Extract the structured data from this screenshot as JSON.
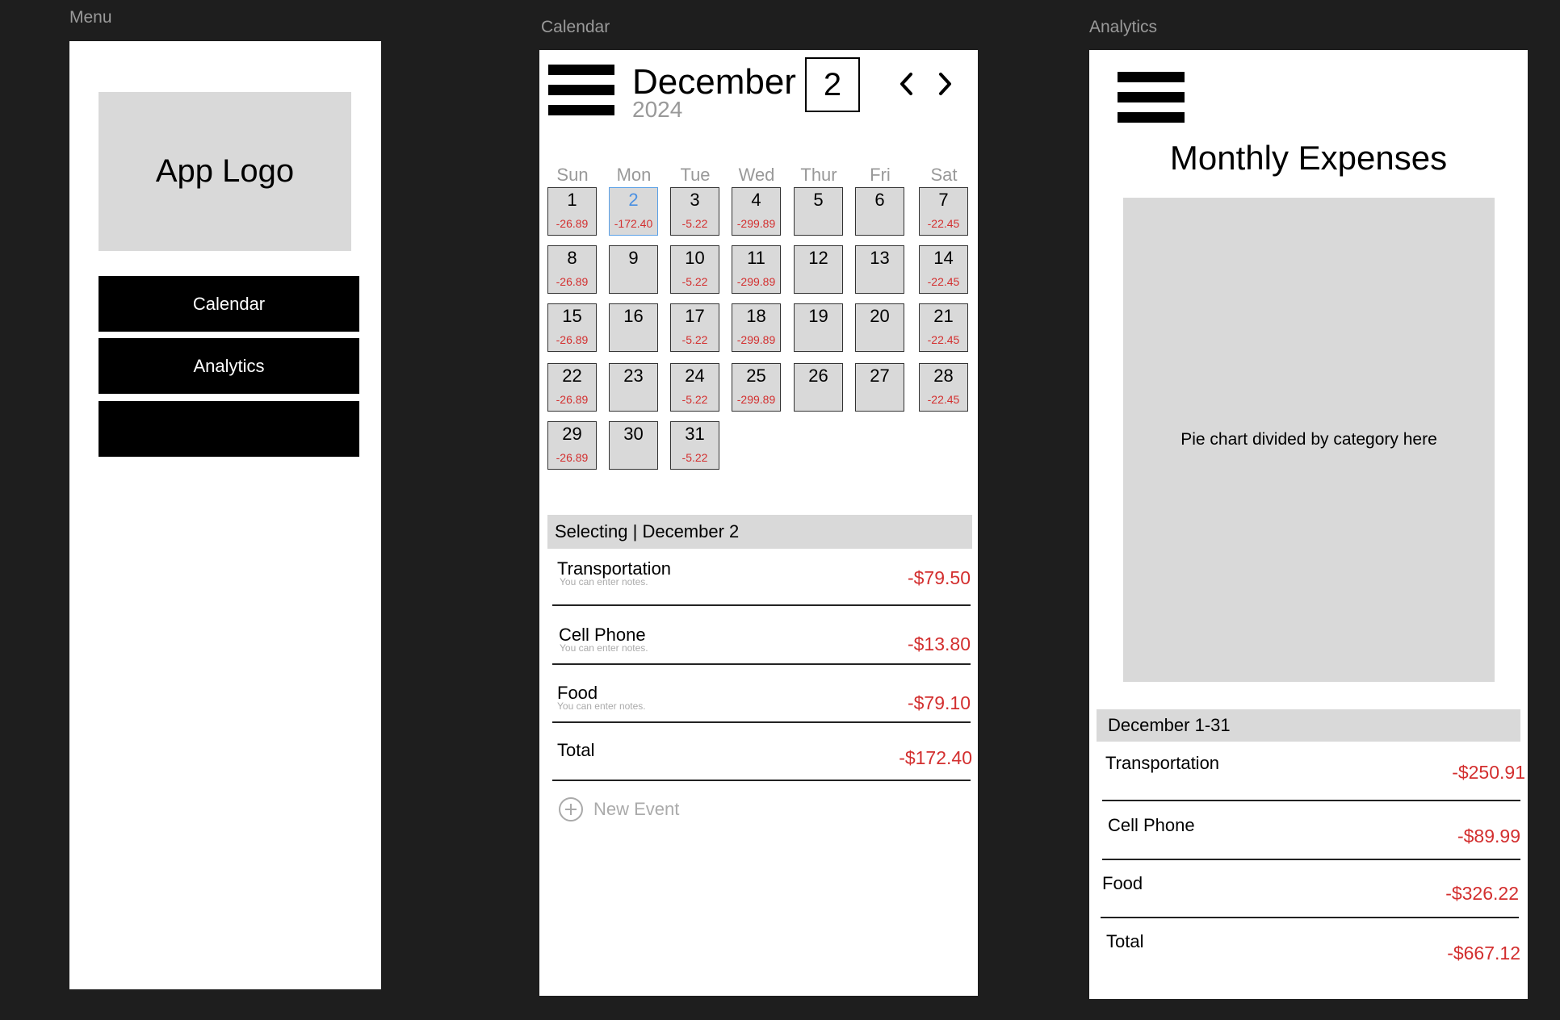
{
  "frames": {
    "menu_label": "Menu",
    "calendar_label": "Calendar",
    "analytics_label": "Analytics"
  },
  "menu": {
    "logo_text": "App Logo",
    "buttons": [
      "Calendar",
      "Analytics",
      ""
    ]
  },
  "calendar": {
    "month": "December",
    "year": "2024",
    "selected_day": "2",
    "weekdays": [
      "Sun",
      "Mon",
      "Tue",
      "Wed",
      "Thur",
      "Fri",
      "Sat"
    ],
    "days": [
      {
        "day": "1",
        "amount": "-26.89"
      },
      {
        "day": "2",
        "amount": "-172.40",
        "selected": true
      },
      {
        "day": "3",
        "amount": "-5.22"
      },
      {
        "day": "4",
        "amount": "-299.89"
      },
      {
        "day": "5",
        "amount": ""
      },
      {
        "day": "6",
        "amount": ""
      },
      {
        "day": "7",
        "amount": "-22.45"
      },
      {
        "day": "8",
        "amount": "-26.89"
      },
      {
        "day": "9",
        "amount": ""
      },
      {
        "day": "10",
        "amount": "-5.22"
      },
      {
        "day": "11",
        "amount": "-299.89"
      },
      {
        "day": "12",
        "amount": ""
      },
      {
        "day": "13",
        "amount": ""
      },
      {
        "day": "14",
        "amount": "-22.45"
      },
      {
        "day": "15",
        "amount": "-26.89"
      },
      {
        "day": "16",
        "amount": ""
      },
      {
        "day": "17",
        "amount": "-5.22"
      },
      {
        "day": "18",
        "amount": "-299.89"
      },
      {
        "day": "19",
        "amount": ""
      },
      {
        "day": "20",
        "amount": ""
      },
      {
        "day": "21",
        "amount": "-22.45"
      },
      {
        "day": "22",
        "amount": "-26.89"
      },
      {
        "day": "23",
        "amount": ""
      },
      {
        "day": "24",
        "amount": "-5.22"
      },
      {
        "day": "25",
        "amount": "-299.89"
      },
      {
        "day": "26",
        "amount": ""
      },
      {
        "day": "27",
        "amount": ""
      },
      {
        "day": "28",
        "amount": "-22.45"
      },
      {
        "day": "29",
        "amount": "-26.89"
      },
      {
        "day": "30",
        "amount": ""
      },
      {
        "day": "31",
        "amount": "-5.22"
      }
    ],
    "selection_label": "Selecting | December 2",
    "expenses": [
      {
        "name": "Transportation",
        "note": "You can enter notes.",
        "value": "-$79.50"
      },
      {
        "name": "Cell Phone",
        "note": "You can enter notes.",
        "value": "-$13.80"
      },
      {
        "name": "Food",
        "note": "You can enter notes.",
        "value": "-$79.10"
      },
      {
        "name": "Total",
        "note": "",
        "value": "-$172.40"
      }
    ],
    "new_event_label": "New Event"
  },
  "analytics": {
    "title": "Monthly Expenses",
    "pie_placeholder": "Pie chart divided by category here",
    "range_label": "December 1-31",
    "summary": [
      {
        "name": "Transportation",
        "value": "-$250.91"
      },
      {
        "name": "Cell Phone",
        "value": "-$89.99"
      },
      {
        "name": "Food",
        "value": "-$326.22"
      },
      {
        "name": "Total",
        "value": "-$667.12"
      }
    ]
  }
}
